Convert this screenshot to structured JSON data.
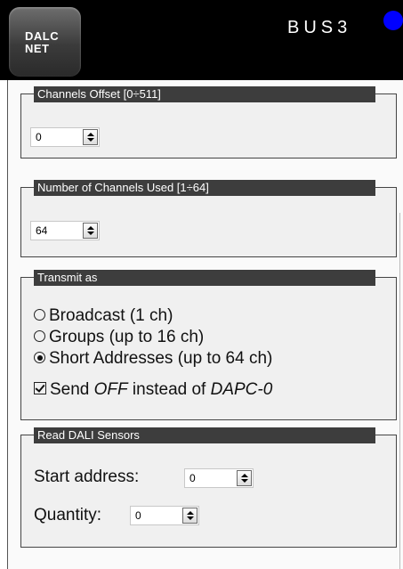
{
  "header": {
    "logo_line1": "DALC",
    "logo_line2": "NET",
    "bus_label": "BUS3",
    "status_color": "#0000ff"
  },
  "channels_offset": {
    "title": "Channels Offset [0÷511]",
    "value": "0"
  },
  "channels_used": {
    "title": "Number of Channels Used [1÷64]",
    "value": "64"
  },
  "transmit": {
    "title": "Transmit as",
    "options": [
      {
        "label": "Broadcast (1 ch)",
        "selected": false
      },
      {
        "label": "Groups (up to 16 ch)",
        "selected": false
      },
      {
        "label": "Short Addresses (up to 64 ch)",
        "selected": true
      }
    ],
    "send_off": {
      "prefix": "Send ",
      "em1": "OFF",
      "middle": " instead of ",
      "em2": "DAPC-0",
      "checked": true
    }
  },
  "sensors": {
    "title": "Read DALI Sensors",
    "start_label": "Start address:",
    "start_value": "0",
    "quantity_label": "Quantity:",
    "quantity_value": "0"
  }
}
